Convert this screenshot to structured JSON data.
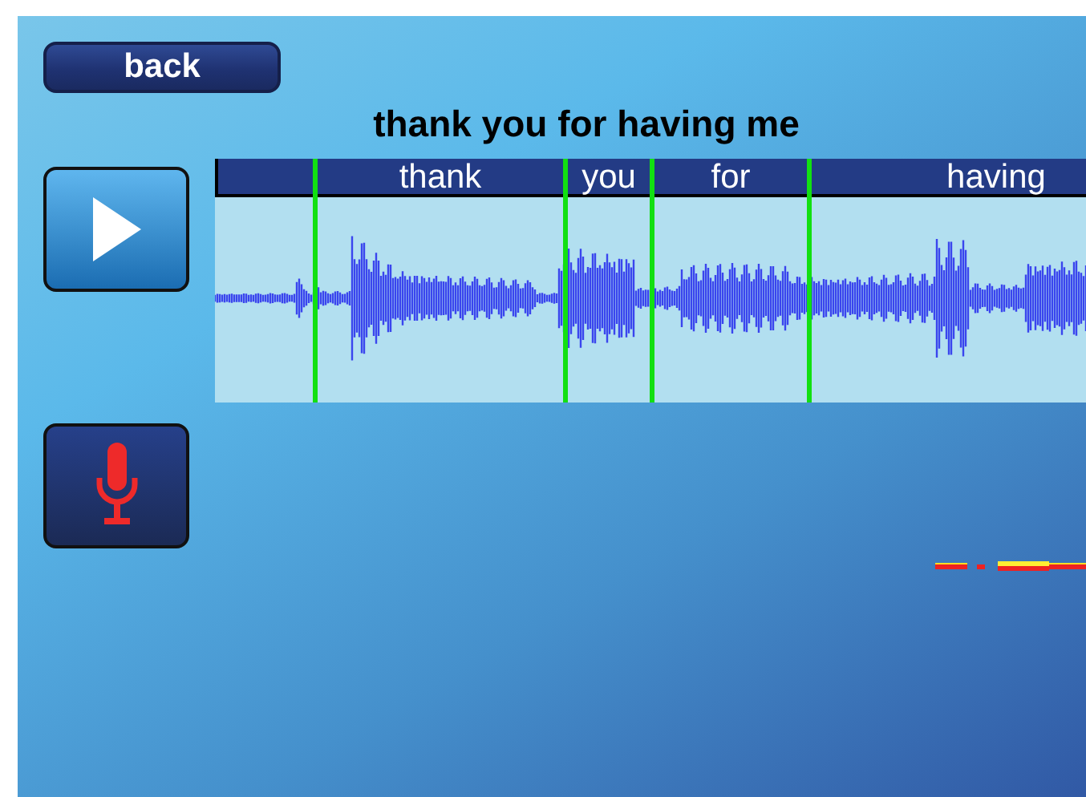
{
  "back_button": {
    "label": "back"
  },
  "sentence": "thank you for having me",
  "words": [
    {
      "text": "thank"
    },
    {
      "text": "you"
    },
    {
      "text": "for"
    },
    {
      "text": "having"
    }
  ]
}
